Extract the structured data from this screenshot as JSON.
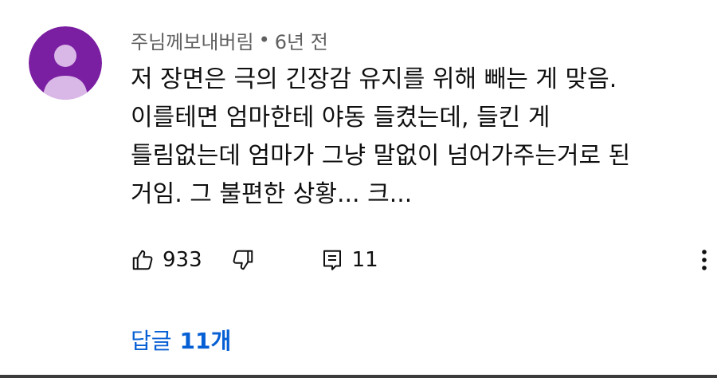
{
  "comment": {
    "author": "주님께보내버림",
    "separator": "•",
    "timestamp": "6년 전",
    "text": "저 장면은 극의 긴장감 유지를 위해 빼는 게 맞음.\n이를테면 엄마한테 야동 들켰는데, 들킨 게\n틀림없는데 엄마가 그냥 말없이 넘어가주는거로 된\n거임. 그 불편한 상황... 크...",
    "like_count": "933",
    "reply_count": "11",
    "replies_link": {
      "prefix": "답글",
      "count": "11개"
    },
    "avatar_color": "#7b1fa2",
    "avatar_silhouette_color": "#d9b8e8",
    "link_color": "#065fd4"
  }
}
